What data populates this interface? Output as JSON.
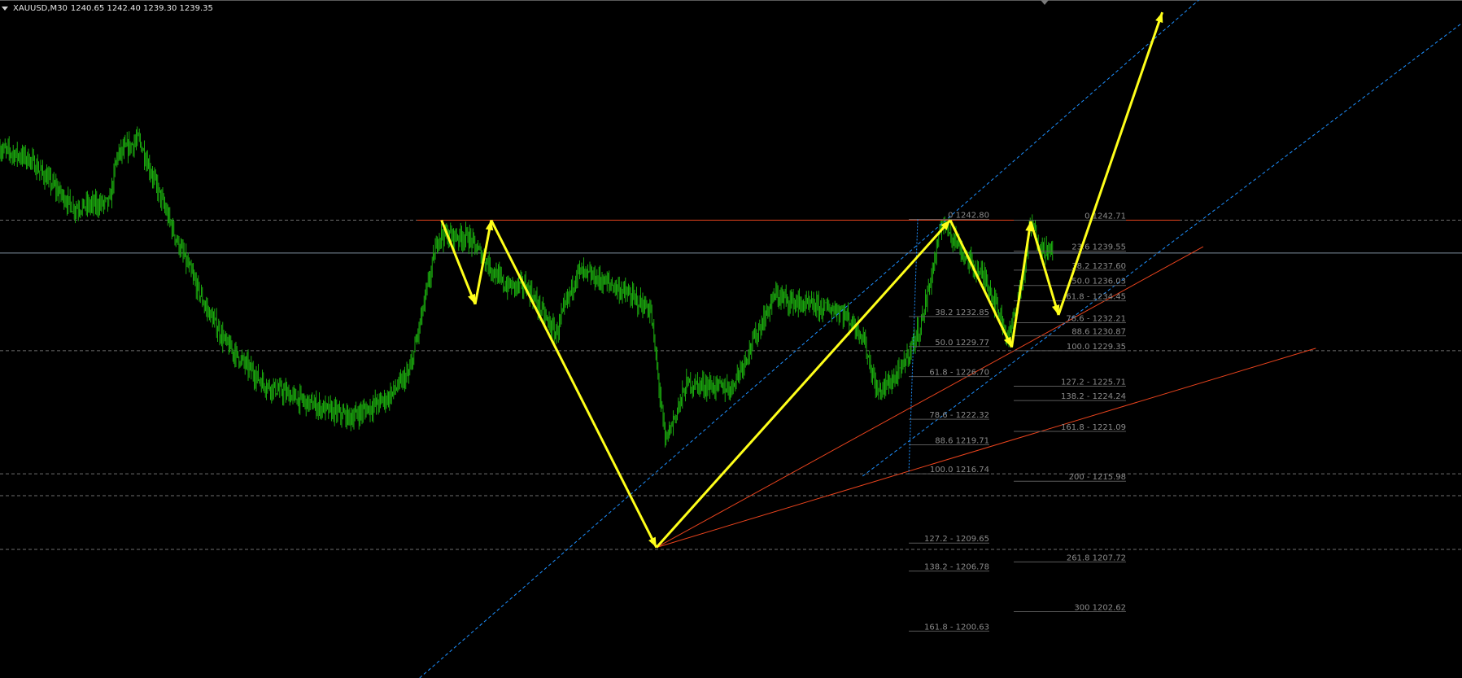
{
  "header": {
    "symbol": "XAUUSD,M30",
    "ohlc": "1240.65 1242.40 1239.30 1239.35"
  },
  "colors": {
    "background": "#000000",
    "price_bars": "#1aa80e",
    "zigzag": "#ffff1a",
    "trend": "#e8431d",
    "channel": "#1e90ff",
    "level_dashed": "#6e6e6e",
    "level_solid": "#7f8f9f",
    "fib_text": "#8a8a8a"
  },
  "chart_data": {
    "type": "line",
    "symbol": "XAUUSD",
    "timeframe": "M30",
    "ohlc_last": {
      "open": 1240.65,
      "high": 1242.4,
      "low": 1239.3,
      "close": 1239.35
    },
    "ylim": [
      1195.83,
      1265.26
    ],
    "price_path": [
      [
        0,
        1250.0
      ],
      [
        0.02,
        1249.0
      ],
      [
        0.05,
        1244.0
      ],
      [
        0.075,
        1244.5
      ],
      [
        0.08,
        1249.3
      ],
      [
        0.095,
        1251.0
      ],
      [
        0.12,
        1241.0
      ],
      [
        0.14,
        1234.0
      ],
      [
        0.155,
        1230.0
      ],
      [
        0.18,
        1226.0
      ],
      [
        0.21,
        1224.0
      ],
      [
        0.24,
        1222.5
      ],
      [
        0.265,
        1224.5
      ],
      [
        0.28,
        1227.0
      ],
      [
        0.3,
        1241.2
      ],
      [
        0.32,
        1241.0
      ],
      [
        0.345,
        1236.0
      ],
      [
        0.36,
        1236.0
      ],
      [
        0.38,
        1231.0
      ],
      [
        0.395,
        1237.5
      ],
      [
        0.42,
        1236.0
      ],
      [
        0.445,
        1233.5
      ],
      [
        0.455,
        1220.0
      ],
      [
        0.47,
        1226.0
      ],
      [
        0.5,
        1225.5
      ],
      [
        0.53,
        1235.0
      ],
      [
        0.55,
        1234.0
      ],
      [
        0.575,
        1233.5
      ],
      [
        0.59,
        1231.0
      ],
      [
        0.6,
        1225.0
      ],
      [
        0.615,
        1227.0
      ],
      [
        0.63,
        1232.0
      ],
      [
        0.645,
        1242.8
      ],
      [
        0.66,
        1239.0
      ],
      [
        0.675,
        1236.5
      ],
      [
        0.69,
        1230.6
      ],
      [
        0.7,
        1237.0
      ],
      [
        0.705,
        1242.5
      ],
      [
        0.712,
        1240.0
      ],
      [
        0.72,
        1239.35
      ]
    ],
    "levels": {
      "dashed": [
        1242.71,
        1229.35,
        1216.74,
        1214.5,
        1209.0
      ],
      "solid": [
        1239.35
      ]
    },
    "resistance_line": 1242.71,
    "zigzag": [
      [
        0.302,
        1242.71
      ],
      [
        0.325,
        1234.1
      ],
      [
        0.336,
        1242.71
      ],
      [
        0.449,
        1209.2
      ],
      [
        0.65,
        1242.71
      ],
      [
        0.692,
        1229.7
      ],
      [
        0.705,
        1242.6
      ],
      [
        0.724,
        1233.0
      ],
      [
        0.795,
        1264.0
      ]
    ],
    "trendlines": [
      {
        "from": [
          0.449,
          1209.2
        ],
        "to": [
          0.823,
          1240.0
        ]
      },
      {
        "from": [
          0.449,
          1209.2
        ],
        "to": [
          0.9,
          1229.6
        ]
      }
    ],
    "channel_lines": [
      {
        "from": [
          0.287,
          1195.83
        ],
        "to": [
          0.82,
          1265.26
        ]
      },
      {
        "from": [
          0.59,
          1216.5
        ],
        "to": [
          1.0,
          1262.9
        ]
      }
    ],
    "fib_sets": [
      {
        "levels": [
          {
            "ratio": "0",
            "price": 1242.8,
            "label": "0 1242.80"
          },
          {
            "ratio": "38.2",
            "price": 1232.85,
            "label": "38.2 1232.85"
          },
          {
            "ratio": "50.0",
            "price": 1229.77,
            "label": "50.0 1229.77"
          },
          {
            "ratio": "61.8",
            "price": 1226.7,
            "label": "61.8 - 1226.70"
          },
          {
            "ratio": "78.6",
            "price": 1222.32,
            "label": "78.6 - 1222.32"
          },
          {
            "ratio": "88.6",
            "price": 1219.71,
            "label": "88.6 1219.71"
          },
          {
            "ratio": "100.0",
            "price": 1216.74,
            "label": "100.0 1216.74"
          },
          {
            "ratio": "127.2",
            "price": 1209.65,
            "label": "127.2 - 1209.65"
          },
          {
            "ratio": "138.2",
            "price": 1206.78,
            "label": "138.2 - 1206.78"
          },
          {
            "ratio": "161.8",
            "price": 1200.63,
            "label": "161.8 - 1200.63"
          }
        ]
      },
      {
        "levels": [
          {
            "ratio": "0",
            "price": 1242.71,
            "label": "0 1242.71"
          },
          {
            "ratio": "23.6",
            "price": 1239.55,
            "label": "23.6 1239.55"
          },
          {
            "ratio": "38.2",
            "price": 1237.6,
            "label": "38.2 1237.60"
          },
          {
            "ratio": "50.0",
            "price": 1236.03,
            "label": "50.0 1236.03"
          },
          {
            "ratio": "61.8",
            "price": 1234.45,
            "label": "61.8 - 1234.45"
          },
          {
            "ratio": "78.6",
            "price": 1232.21,
            "label": "78.6 - 1232.21"
          },
          {
            "ratio": "88.6",
            "price": 1230.87,
            "label": "88.6 1230.87"
          },
          {
            "ratio": "100.0",
            "price": 1229.35,
            "label": "100.0 1229.35"
          },
          {
            "ratio": "127.2",
            "price": 1225.71,
            "label": "127.2 - 1225.71"
          },
          {
            "ratio": "138.2",
            "price": 1224.24,
            "label": "138.2 - 1224.24"
          },
          {
            "ratio": "161.8",
            "price": 1221.09,
            "label": "161.8 - 1221.09"
          },
          {
            "ratio": "200",
            "price": 1215.98,
            "label": "200 - 1215.98"
          },
          {
            "ratio": "261.8",
            "price": 1207.72,
            "label": "261.8 1207.72"
          },
          {
            "ratio": "300",
            "price": 1202.62,
            "label": "300 1202.62"
          }
        ]
      }
    ]
  }
}
